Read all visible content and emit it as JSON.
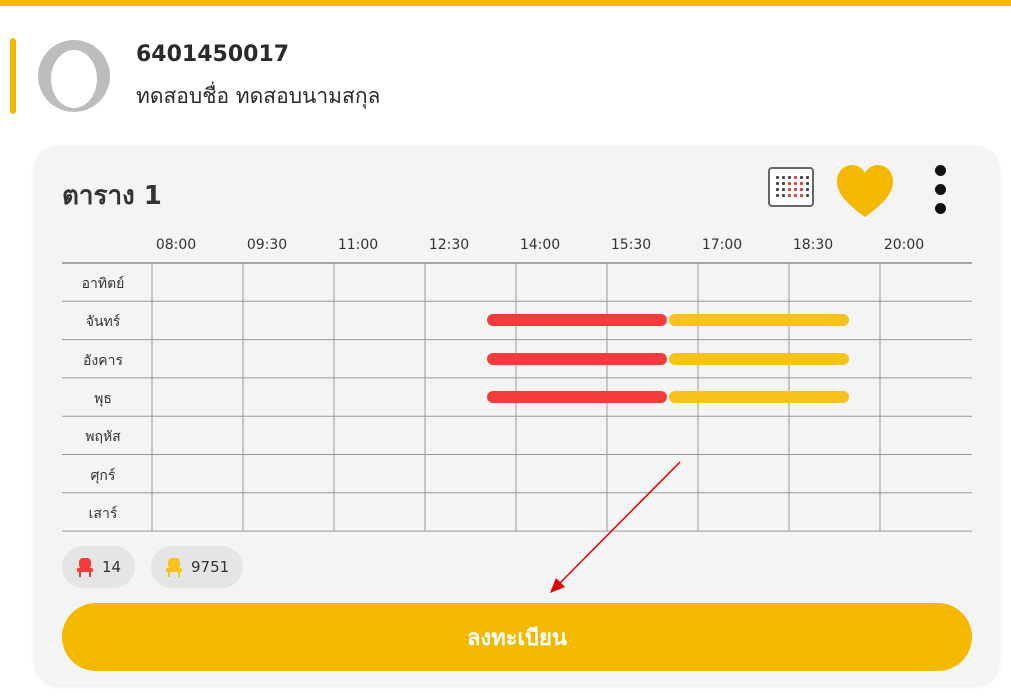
{
  "profile": {
    "student_id": "6401450017",
    "student_name": "ทดสอบชื่อ ทดสอบนามสกุล"
  },
  "schedule": {
    "title": "ตาราง 1",
    "time_labels": [
      "08:00",
      "09:30",
      "11:00",
      "12:30",
      "14:00",
      "15:30",
      "17:00",
      "18:30",
      "20:00"
    ],
    "days": [
      "อาทิตย์",
      "จันทร์",
      "อังคาร",
      "พุธ",
      "พฤหัส",
      "ศุกร์",
      "เสาร์"
    ],
    "sessions": [
      {
        "day": "จันทร์",
        "start": "12:30",
        "end": "15:30",
        "color": "#f53b3b"
      },
      {
        "day": "จันทร์",
        "start": "15:30",
        "end": "18:30",
        "color": "#f7c21a"
      },
      {
        "day": "อังคาร",
        "start": "12:30",
        "end": "15:30",
        "color": "#f53b3b"
      },
      {
        "day": "อังคาร",
        "start": "15:30",
        "end": "18:30",
        "color": "#f7c21a"
      },
      {
        "day": "พุธ",
        "start": "12:30",
        "end": "15:30",
        "color": "#f53b3b"
      },
      {
        "day": "พุธ",
        "start": "15:30",
        "end": "18:30",
        "color": "#f7c21a"
      }
    ]
  },
  "seats": {
    "red_count": "14",
    "yellow_count": "9751"
  },
  "actions": {
    "register_label": "ลงทะเบียน"
  },
  "colors": {
    "accent": "#f5b800",
    "red_session": "#f53b3b",
    "yellow_session": "#f7c21a",
    "annotation_arrow": "#e00000"
  },
  "icons": [
    "calendar-grid-icon",
    "heart-icon",
    "more-vertical-icon",
    "seat-red-icon",
    "seat-yellow-icon"
  ]
}
